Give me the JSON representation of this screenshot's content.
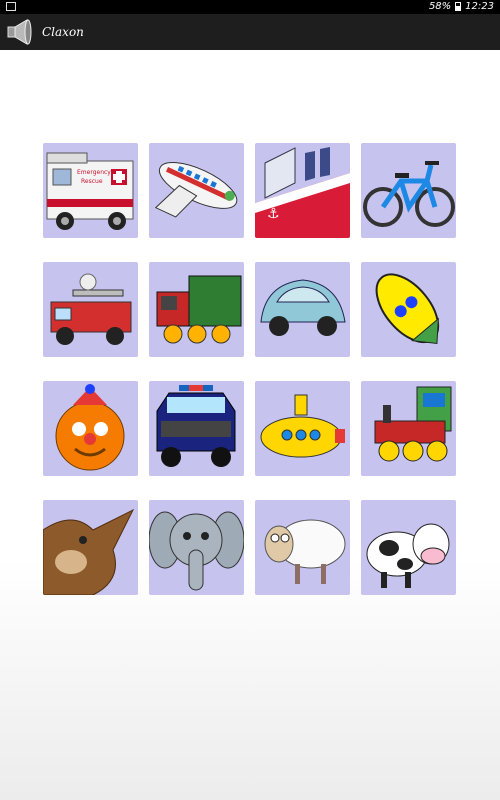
{
  "status_bar": {
    "battery": "58%",
    "time": "12:23"
  },
  "app": {
    "title": "Claxon",
    "icon": "horn-icon"
  },
  "tiles": [
    {
      "name": "ambulance",
      "labels": [
        "Emergency",
        "Rescue"
      ]
    },
    {
      "name": "airplane"
    },
    {
      "name": "ship"
    },
    {
      "name": "bicycle"
    },
    {
      "name": "fire-truck"
    },
    {
      "name": "truck"
    },
    {
      "name": "car"
    },
    {
      "name": "rocket"
    },
    {
      "name": "clown"
    },
    {
      "name": "police-car"
    },
    {
      "name": "submarine"
    },
    {
      "name": "train"
    },
    {
      "name": "donkey"
    },
    {
      "name": "elephant"
    },
    {
      "name": "sheep"
    },
    {
      "name": "cow"
    }
  ],
  "colors": {
    "tile_bg": "#c6c3ee",
    "action_bar": "#1e1e1e",
    "status_bar": "#000000"
  }
}
